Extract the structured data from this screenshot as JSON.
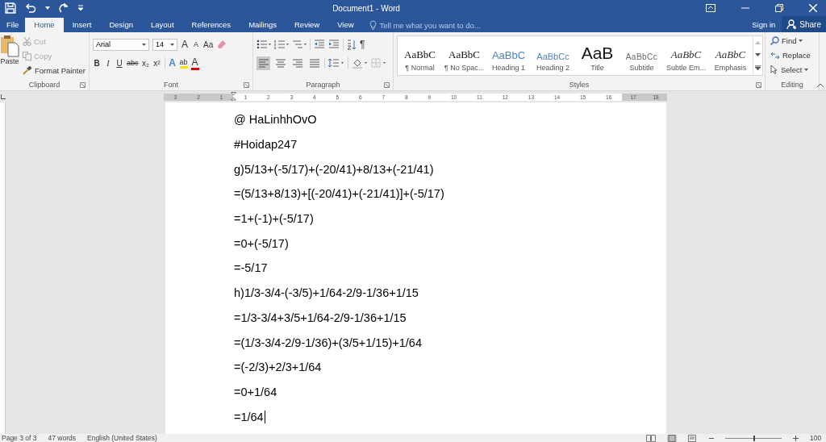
{
  "title_bar": {
    "title": "Document1 - Word"
  },
  "tabs": [
    {
      "label": "File",
      "selected": false,
      "kind": "file"
    },
    {
      "label": "Home",
      "selected": true,
      "kind": "tab"
    },
    {
      "label": "Insert",
      "selected": false,
      "kind": "tab"
    },
    {
      "label": "Design",
      "selected": false,
      "kind": "tab"
    },
    {
      "label": "Layout",
      "selected": false,
      "kind": "tab"
    },
    {
      "label": "References",
      "selected": false,
      "kind": "tab"
    },
    {
      "label": "Mailings",
      "selected": false,
      "kind": "tab"
    },
    {
      "label": "Review",
      "selected": false,
      "kind": "tab"
    },
    {
      "label": "View",
      "selected": false,
      "kind": "tab"
    }
  ],
  "tell_me": {
    "placeholder": "Tell me what you want to do..."
  },
  "account": {
    "sign_in": "Sign in",
    "share": "Share"
  },
  "clipboard": {
    "paste": "Paste",
    "cut": {
      "label": "Cut",
      "disabled": true
    },
    "copy": {
      "label": "Copy",
      "disabled": true
    },
    "format_painter": "Format Painter",
    "label": "Clipboard"
  },
  "font": {
    "font_name": "Arial",
    "font_size": "14",
    "grow": "A",
    "shrink": "A",
    "change_case": "Aa",
    "format_buttons": [
      "B",
      "I",
      "U",
      "abc",
      "x₂",
      "x²"
    ],
    "text_effects": "A",
    "highlight": "ab",
    "font_color": "A",
    "label": "Font"
  },
  "paragraph": {
    "show_marks": "¶",
    "alignments": [
      {
        "kind": "left",
        "selected": true
      },
      {
        "kind": "center",
        "selected": false
      },
      {
        "kind": "right",
        "selected": false
      },
      {
        "kind": "justify",
        "selected": false
      }
    ],
    "label": "Paragraph"
  },
  "styles": {
    "items": [
      {
        "preview": "AaBbC",
        "label": "¶ Normal",
        "kind": "normal"
      },
      {
        "preview": "AaBbC",
        "label": "¶ No Spac...",
        "kind": "normal"
      },
      {
        "preview": "AaBbC",
        "label": "Heading 1",
        "kind": "heading1"
      },
      {
        "preview": "AaBbCc",
        "label": "Heading 2",
        "kind": "heading2"
      },
      {
        "preview": "AaB",
        "label": "Title",
        "kind": "title"
      },
      {
        "preview": "AaBbCc",
        "label": "Subtitle",
        "kind": "subtitle"
      },
      {
        "preview": "AaBbC",
        "label": "Subtle Em...",
        "kind": "emphasis"
      },
      {
        "preview": "AaBbC",
        "label": "Emphasis",
        "kind": "emphasis"
      }
    ],
    "label": "Styles"
  },
  "editing": {
    "find": "Find",
    "replace": "Replace",
    "select": "Select",
    "label": "Editing"
  },
  "ruler": {
    "left_numbers": [
      "3",
      "2",
      "1"
    ],
    "numbers": [
      "1",
      "2",
      "3",
      "4",
      "5",
      "6",
      "7",
      "8",
      "9",
      "10",
      "11",
      "12",
      "13",
      "14",
      "15",
      "16"
    ],
    "right_numbers": [
      "17",
      "18"
    ]
  },
  "document": {
    "lines": [
      "@ HaLinhhOvO",
      "#Hoidap247",
      "g)5/13+(-5/17)+(-20/41)+8/13+(-21/41)",
      "=(5/13+8/13)+[(-20/41)+(-21/41)]+(-5/17)",
      "=1+(-1)+(-5/17)",
      "=0+(-5/17)",
      "=-5/17",
      "h)1/3-3/4-(-3/5)+1/64-2/9-1/36+1/15",
      "=1/3-3/4+3/5+1/64-2/9-1/36+1/15",
      "=(1/3-3/4-2/9-1/36)+(3/5+1/15)+1/64",
      "=(-2/3)+2/3+1/64",
      "=0+1/64",
      "=1/64"
    ]
  },
  "status_bar": {
    "page": "Page 3 of 3",
    "words": "47 words",
    "language": "English (United States)",
    "zoom": "100",
    "zoom_slider": {
      "level": 0.5
    }
  }
}
